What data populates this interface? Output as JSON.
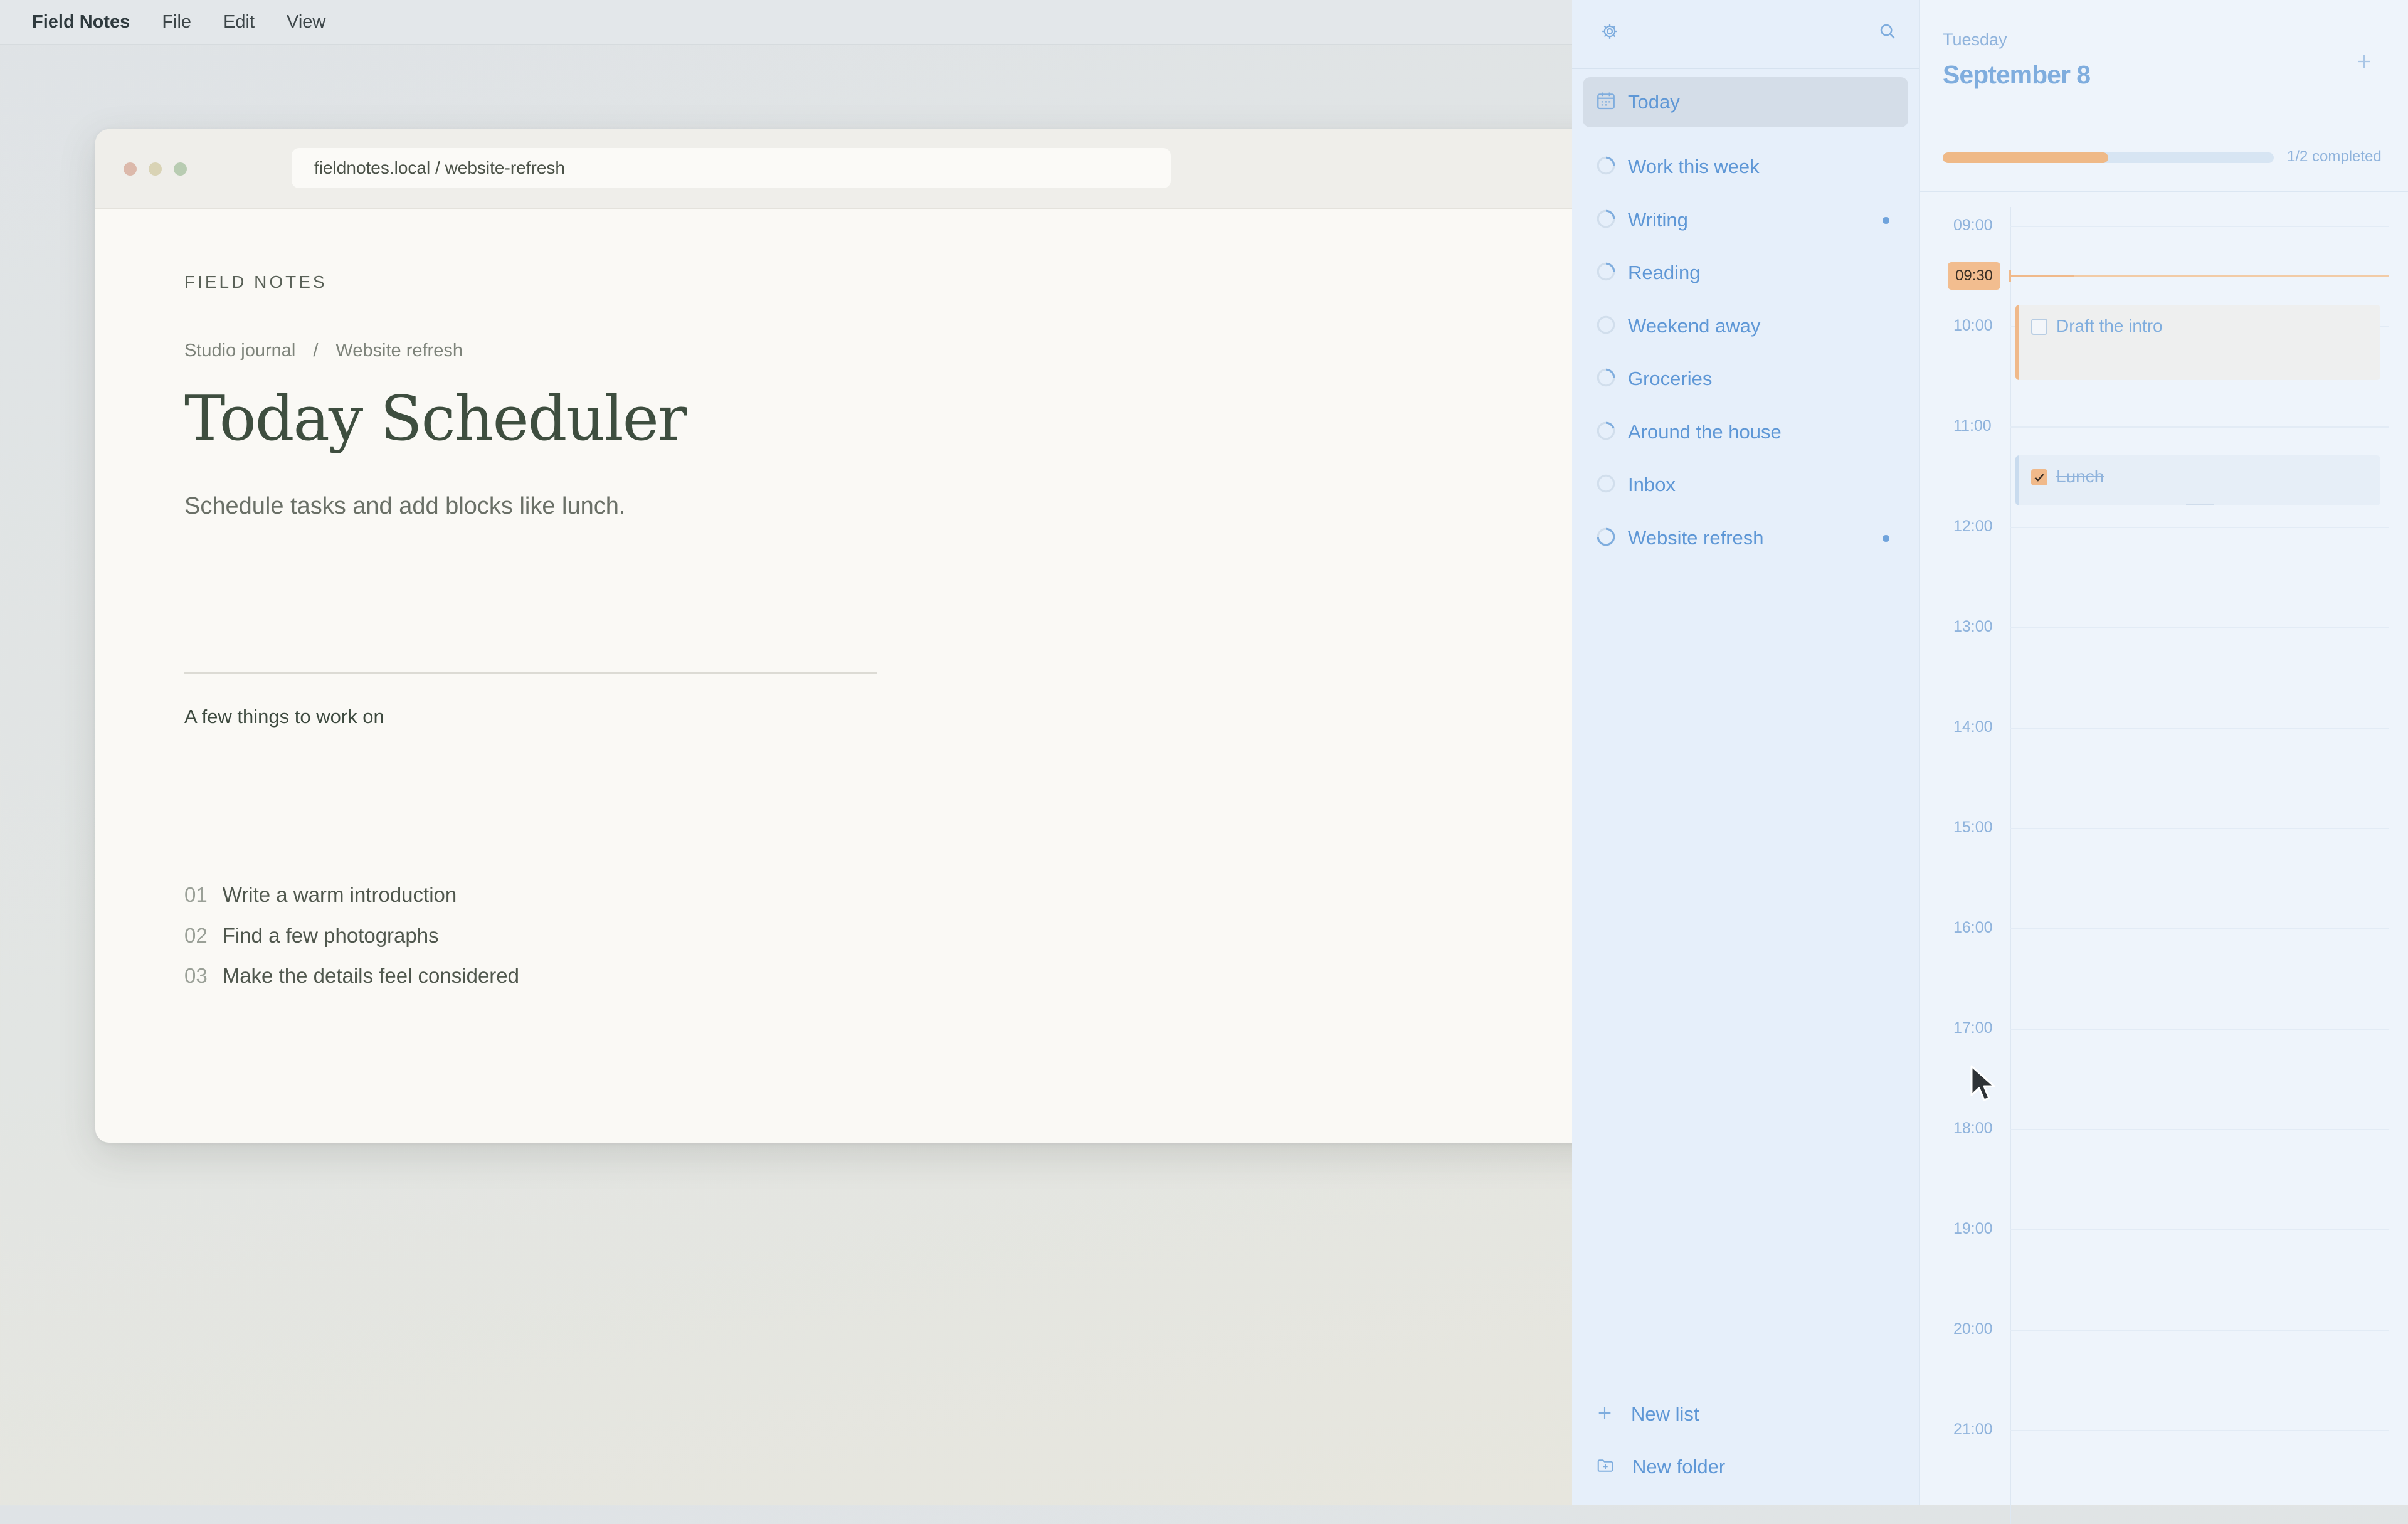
{
  "menubar": {
    "app_name": "Field Notes",
    "menus": [
      "File",
      "Edit",
      "View"
    ]
  },
  "browser": {
    "url": "fieldnotes.local / website-refresh"
  },
  "document": {
    "eyebrow": "FIELD NOTES",
    "breadcrumb": [
      "Studio journal",
      "/",
      "Website refresh"
    ],
    "title": "Today Scheduler",
    "subtitle": "Schedule tasks and add blocks like lunch.",
    "section_title": "A few things to work on",
    "items": [
      {
        "num": "01",
        "text": "Write a warm introduction"
      },
      {
        "num": "02",
        "text": "Find a few photographs"
      },
      {
        "num": "03",
        "text": "Make the details feel considered"
      }
    ]
  },
  "sidebar": {
    "top_icons": [
      "gear-icon",
      "search-icon"
    ],
    "items": [
      {
        "label": "Today",
        "icon": "calendar-icon",
        "active": true,
        "unread": false
      },
      {
        "label": "Work this week",
        "icon": "progress-ring-icon",
        "active": false,
        "unread": false
      },
      {
        "label": "Writing",
        "icon": "progress-ring-icon",
        "active": false,
        "unread": true
      },
      {
        "label": "Reading",
        "icon": "progress-ring-icon",
        "active": false,
        "unread": false
      },
      {
        "label": "Weekend away",
        "icon": "progress-ring-icon",
        "active": false,
        "unread": false
      },
      {
        "label": "Groceries",
        "icon": "progress-ring-icon",
        "active": false,
        "unread": false
      },
      {
        "label": "Around the house",
        "icon": "progress-ring-icon",
        "active": false,
        "unread": false
      },
      {
        "label": "Inbox",
        "icon": "progress-ring-icon",
        "active": false,
        "unread": false
      },
      {
        "label": "Website refresh",
        "icon": "progress-ring-icon",
        "active": false,
        "unread": true
      }
    ],
    "footer": {
      "new_list": "New list",
      "new_folder": "New folder"
    }
  },
  "day": {
    "weekday": "Tuesday",
    "date": "September 8",
    "progress_fraction": 0.5,
    "progress_text": "1/2 completed",
    "hours": [
      "09:00",
      "10:00",
      "11:00",
      "12:00",
      "13:00",
      "14:00",
      "15:00",
      "16:00",
      "17:00",
      "18:00",
      "19:00",
      "20:00",
      "21:00"
    ],
    "now": "09:30",
    "events": [
      {
        "title": "Draft the intro",
        "start": "10:00",
        "end": "10:45",
        "done": false
      },
      {
        "title": "Lunch",
        "start": "11:30",
        "end": "12:00",
        "done": true
      }
    ]
  },
  "colors": {
    "accent": "#7fadde",
    "now_marker": "#f2bd8f",
    "title_text": "#3e4e3f"
  }
}
